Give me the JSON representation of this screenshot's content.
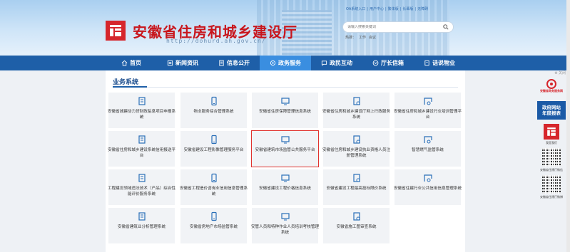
{
  "header": {
    "title": "安徽省住房和城乡建设厅",
    "url": "http://dohurd.ah.gov.cn/",
    "top_links": [
      "OA系统入口",
      "|",
      "用户中心",
      "|",
      "繁体版",
      "|",
      "长辈版",
      "|",
      "无障碍"
    ],
    "search_placeholder": "请输入搜索关键词",
    "hot_words": [
      "热搜：",
      "工作",
      "会议"
    ]
  },
  "nav": {
    "items": [
      {
        "label": "首页",
        "icon": "home-icon"
      },
      {
        "label": "新闻资讯",
        "icon": "news-icon"
      },
      {
        "label": "信息公开",
        "icon": "document-icon"
      },
      {
        "label": "政务服务",
        "icon": "service-icon",
        "active": true
      },
      {
        "label": "政民互动",
        "icon": "chat-icon"
      },
      {
        "label": "厅长信箱",
        "icon": "mail-icon"
      },
      {
        "label": "话说物业",
        "icon": "building-icon"
      }
    ],
    "active_color": "#3a8ee0",
    "bar_color": "#1e5fa8"
  },
  "section": {
    "title": "业务系统"
  },
  "systems": [
    "安徽省城建动力贷财政贴息项目申报系统",
    "物业服务综合管理系统",
    "安徽省住房保障管理信息系统",
    "安徽省住房和城乡建设厅网上行政服务系统",
    "安徽省住房和城乡建设行业培训管理平台",
    "安徽省住房和城乡建设系统信用报送平台",
    "安徽省建设工程影像管理服务平台",
    "安徽省建筑市场监管公共服务平台",
    "安徽省住房和城乡建设执业资格人员注册管理系统",
    "智慧燃气监管系统",
    "工程建设领域违法技术（产品）综合性能评价服务系统",
    "安徽省工程造价咨询业信用信息管理系统",
    "安徽省建设工程价格信息系统",
    "安徽省建设工程最高投标限价系统",
    "安徽省住建行业公共信用信息管理系统",
    "安徽省建筑业分析管理系统",
    "安徽省房地产市场监管系统",
    "安管人员和特种作业人员培训考核管理系统",
    "安徽省施工图审查系统"
  ],
  "highlighted_system": "安徽省建筑市场监管公共服务平台",
  "sidebar": {
    "close": "关闭",
    "badge_text": "安徽省政务服务网",
    "report_lines": [
      "政府网站",
      "年度报表"
    ],
    "logo_caption": "我是我们",
    "qr1_caption": "安徽省住建厅微信",
    "qr2_caption": "安徽省住建厅微博"
  },
  "colors": {
    "brand_red": "#c8161d",
    "highlight_border": "#e0322e",
    "tile_bg": "#f1f3f6"
  }
}
